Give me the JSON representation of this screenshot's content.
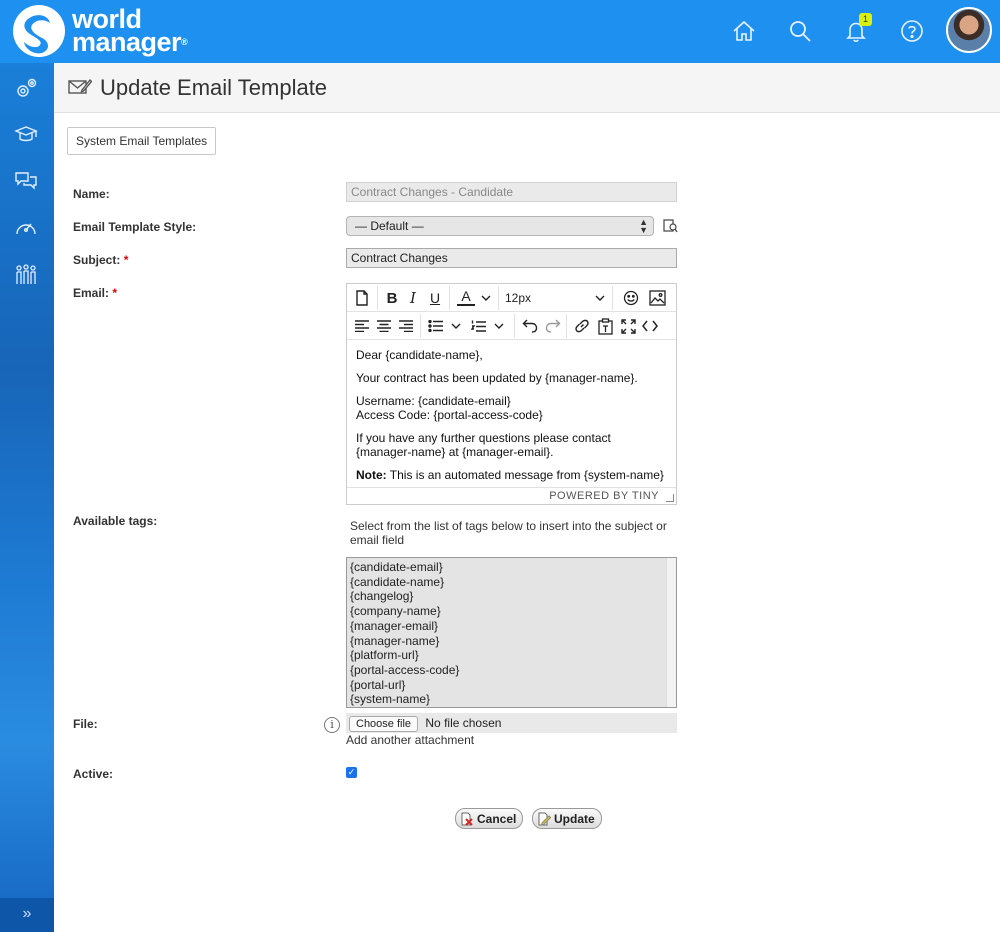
{
  "app": {
    "logo_line1": "world",
    "logo_line2": "manager",
    "logo_reg": "®",
    "notification_count": "1"
  },
  "page": {
    "title": "Update Email Template",
    "breadcrumb_button": "System Email Templates"
  },
  "form": {
    "name_label": "Name:",
    "name_value": "Contract Changes - Candidate",
    "style_label": "Email Template Style:",
    "style_value": "— Default —",
    "subject_label": "Subject:",
    "subject_value": "Contract Changes",
    "email_label": "Email:",
    "required_mark": "*",
    "tags_label": "Available tags:",
    "file_label": "File:",
    "active_label": "Active:",
    "active_checked": true
  },
  "editor": {
    "font_size": "12px",
    "lines": {
      "greeting": "Dear {candidate-name},",
      "updated": "Your contract has been updated by {manager-name}.",
      "username": "Username: {candidate-email}",
      "access_code": "Access Code: {portal-access-code}",
      "questions": "If you have any further questions please contact {manager-name} at {manager-email}.",
      "note_label": "Note:",
      "note_text": " This is an automated message from {system-name}"
    },
    "footer": "POWERED BY TINY"
  },
  "tags": {
    "hint": "Select from the list of tags below to insert into the subject or email field",
    "items": [
      "{candidate-email}",
      "{candidate-name}",
      "{changelog}",
      "{company-name}",
      "{manager-email}",
      "{manager-name}",
      "{platform-url}",
      "{portal-access-code}",
      "{portal-url}",
      "{system-name}"
    ]
  },
  "file": {
    "choose_label": "Choose file",
    "status": "No file chosen",
    "add_another": "Add another attachment"
  },
  "actions": {
    "cancel": "Cancel",
    "update": "Update"
  },
  "colors": {
    "topbar": "#1e90f0",
    "sidebar": "#1765b8",
    "badge": "#d8f00a",
    "checkbox": "#1a73e8"
  }
}
